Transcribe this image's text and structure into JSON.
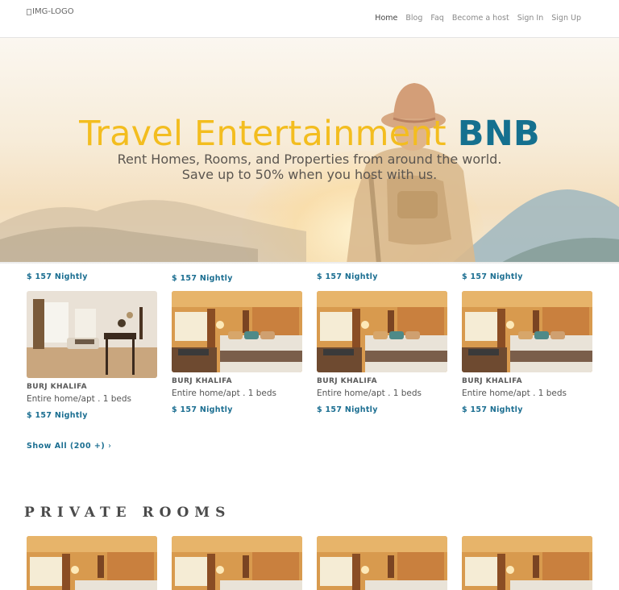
{
  "header": {
    "logo_alt": "IMG-LOGO",
    "nav": [
      {
        "label": "Home"
      },
      {
        "label": "Blog"
      },
      {
        "label": "Faq"
      },
      {
        "label": "Become a host"
      },
      {
        "label": "Sign In"
      },
      {
        "label": "Sign Up"
      }
    ]
  },
  "hero": {
    "title_part1": "Travel Entertainment",
    "title_part2": "BNB",
    "subtitle_line1": "Rent Homes, Rooms, and Properties from around the world.",
    "subtitle_line2": "Save up to 50% when you host with us."
  },
  "top_row_prices": [
    "$ 157 Nightly",
    "$ 157 Nightly",
    "$ 157 Nightly",
    "$ 157 Nightly"
  ],
  "listings": [
    {
      "name": "BURJ KHALIFA",
      "desc": "Entire home/apt . 1 beds",
      "price": "$ 157 Nightly",
      "image": "living-room-photo"
    },
    {
      "name": "BURJ KHALIFA",
      "desc": "Entire home/apt . 1 beds",
      "price": "$ 157 Nightly",
      "image": "hotel-bedroom-photo"
    },
    {
      "name": "BURJ KHALIFA",
      "desc": "Entire home/apt . 1 beds",
      "price": "$ 157 Nightly",
      "image": "hotel-bedroom-photo"
    },
    {
      "name": "BURJ KHALIFA",
      "desc": "Entire home/apt . 1 beds",
      "price": "$ 157 Nightly",
      "image": "hotel-bedroom-photo"
    }
  ],
  "show_all": {
    "label": "Show All (200 +)",
    "chevron": "›"
  },
  "private_rooms": {
    "title": "PRIVATE ROOMS",
    "items": [
      {
        "image": "hotel-bedroom-photo"
      },
      {
        "image": "hotel-bedroom-photo"
      },
      {
        "image": "hotel-bedroom-photo"
      },
      {
        "image": "hotel-bedroom-photo"
      }
    ]
  },
  "colors": {
    "accent_yellow": "#f3bd1f",
    "accent_blue": "#15708f",
    "price_blue": "#1b6e91"
  }
}
